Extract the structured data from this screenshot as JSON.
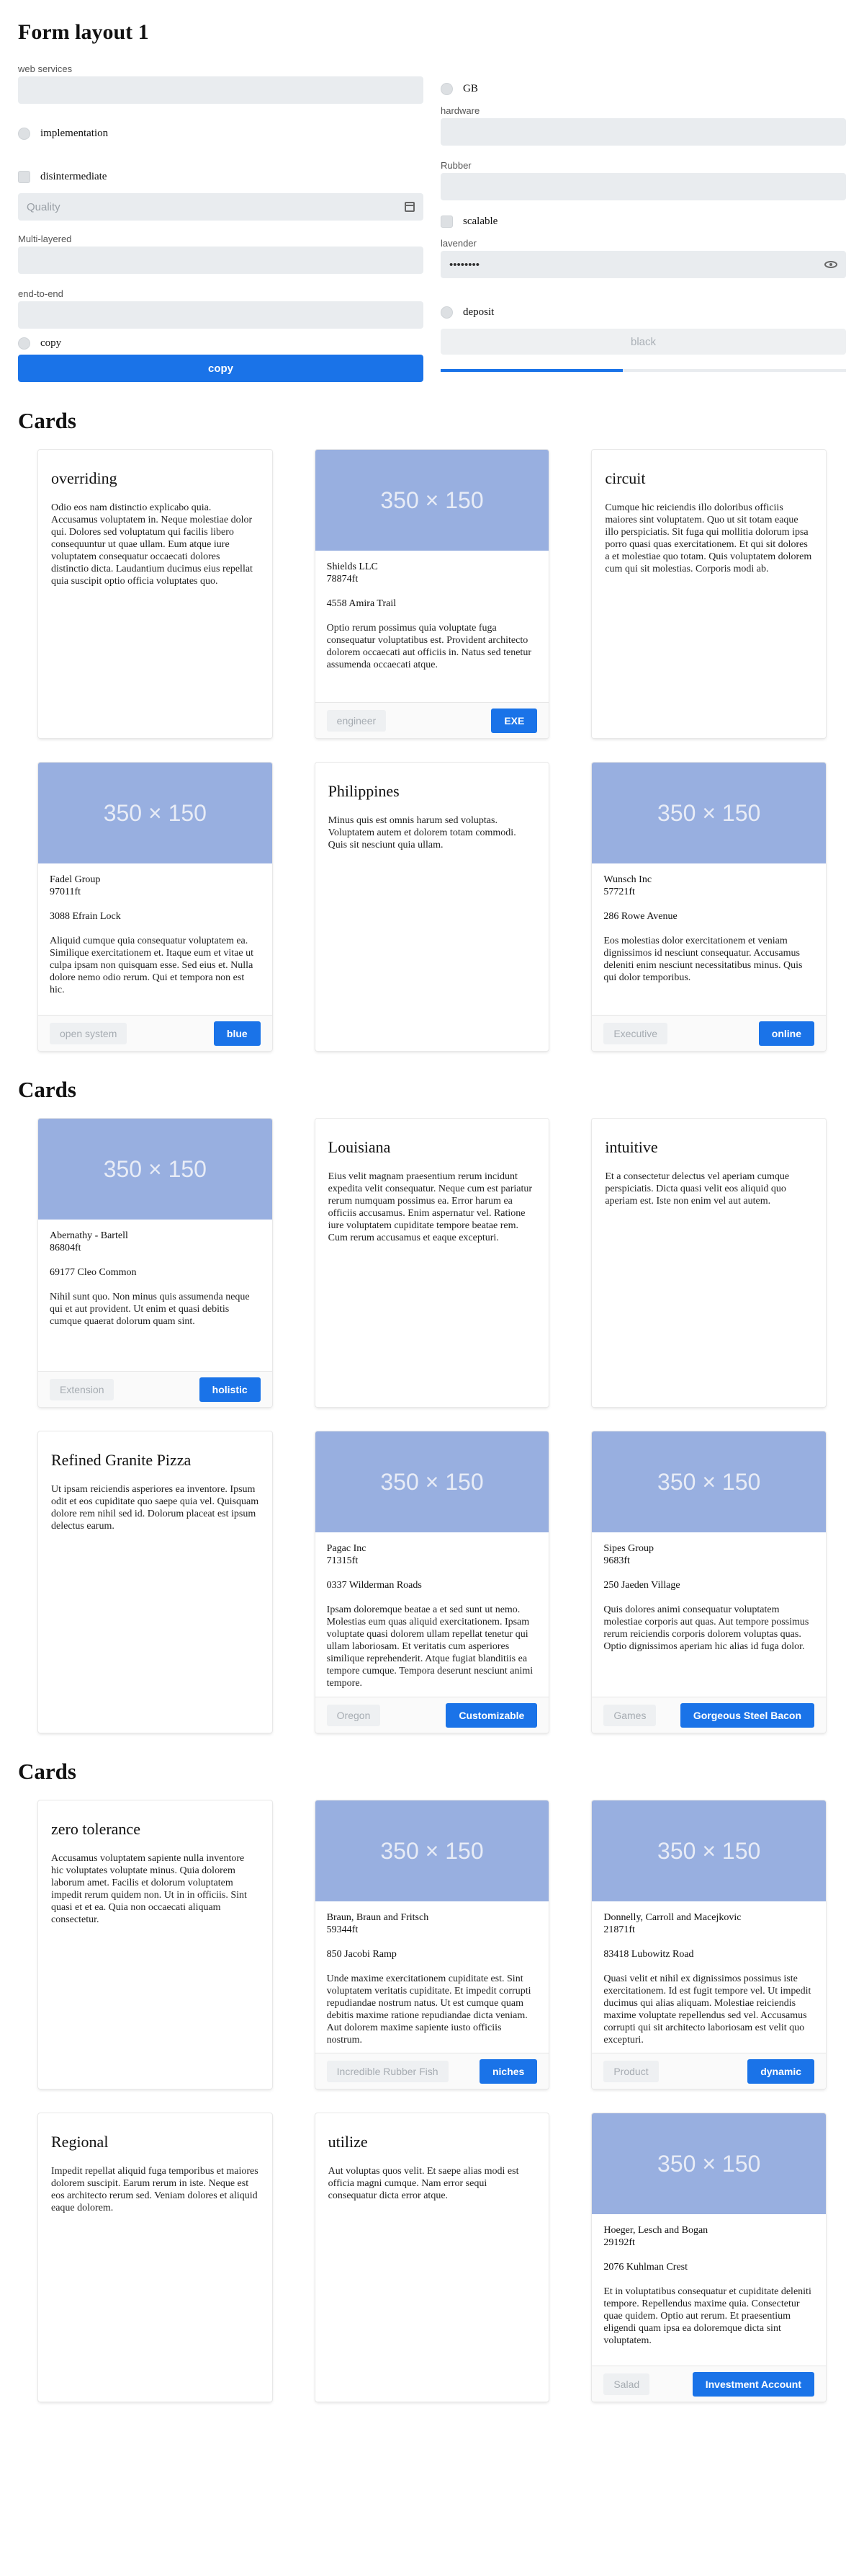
{
  "form": {
    "title": "Form layout 1",
    "left": {
      "web_services_label": "web services",
      "implementation_label": "implementation",
      "disintermediate_label": "disintermediate",
      "date_placeholder": "Quality",
      "multilayered_label": "Multi-layered",
      "end_to_end_label": "end-to-end",
      "copy_radio_label": "copy",
      "submit_label": "copy"
    },
    "right": {
      "gb_label": "GB",
      "hardware_label": "hardware",
      "rubber_label": "Rubber",
      "scalable_label": "scalable",
      "lavender_label": "lavender",
      "password_value": "••••••••",
      "deposit_label": "deposit",
      "disabled_button_label": "black",
      "progress_fraction": 0.45
    }
  },
  "sections": [
    {
      "title": "Cards",
      "rows": [
        [
          {
            "type": "text",
            "title": "overriding",
            "text": "Odio eos nam distinctio explicabo quia. Accusamus voluptatem in. Neque molestiae dolor qui. Dolores sed voluptatum qui facilis libero consequuntur ut quae ullam. Eum atque iure voluptatem consequatur occaecati dolores distinctio dicta. Laudantium ducimus eius repellat quia suscipit optio officia voluptates quo."
          },
          {
            "type": "image",
            "image_label": "350 × 150",
            "company": "Shields LLC",
            "size": "78874ft",
            "address": "4558 Amira Trail",
            "text": "Optio rerum possimus quia voluptate fuga consequatur voluptatibus est. Provident architecto dolorem occaecati aut officiis in. Natus sed tenetur assumenda occaecati atque.",
            "tag": "engineer",
            "action": "EXE"
          },
          {
            "type": "text",
            "title": "circuit",
            "text": "Cumque hic reiciendis illo doloribus officiis maiores sint voluptatem. Quo ut sit totam eaque illo perspiciatis. Sit fuga qui mollitia dolorum ipsa porro quasi quas exercitationem. Et qui sit dolores a et molestiae quo totam. Quis voluptatem dolorem cum qui sit molestias. Corporis modi ab."
          }
        ],
        [
          {
            "type": "image",
            "image_label": "350 × 150",
            "company": "Fadel Group",
            "size": "97011ft",
            "address": "3088 Efrain Lock",
            "text": "Aliquid cumque quia consequatur voluptatem ea. Similique exercitationem et. Itaque eum et vitae ut culpa ipsam non quisquam esse. Sed eius et. Nulla dolore nemo odio rerum. Qui et tempora non est hic.",
            "tag": "open system",
            "action": "blue"
          },
          {
            "type": "text",
            "title": "Philippines",
            "text": "Minus quis est omnis harum sed voluptas. Voluptatem autem et dolorem totam commodi. Quis sit nesciunt quia ullam."
          },
          {
            "type": "image",
            "image_label": "350 × 150",
            "company": "Wunsch Inc",
            "size": "57721ft",
            "address": "286 Rowe Avenue",
            "text": "Eos molestias dolor exercitationem et veniam dignissimos id nesciunt consequatur. Accusamus deleniti enim nesciunt necessitatibus minus. Quis qui dolor temporibus.",
            "tag": "Executive",
            "action": "online"
          }
        ]
      ]
    },
    {
      "title": "Cards",
      "rows": [
        [
          {
            "type": "image",
            "image_label": "350 × 150",
            "company": "Abernathy - Bartell",
            "size": "86804ft",
            "address": "69177 Cleo Common",
            "text": "Nihil sunt quo. Non minus quis assumenda neque qui et aut provident. Ut enim et quasi debitis cumque quaerat dolorum quam sint.",
            "tag": "Extension",
            "action": "holistic"
          },
          {
            "type": "text",
            "title": "Louisiana",
            "text": "Eius velit magnam praesentium rerum incidunt expedita velit consequatur. Neque cum est pariatur rerum numquam possimus ea. Error harum ea officiis accusamus. Enim aspernatur vel. Ratione iure voluptatem cupiditate tempore beatae rem. Cum rerum accusamus et eaque excepturi."
          },
          {
            "type": "text",
            "title": "intuitive",
            "text": "Et a consectetur delectus vel aperiam cumque perspiciatis. Dicta quasi velit eos aliquid quo aperiam est. Iste non enim vel aut autem."
          }
        ],
        [
          {
            "type": "text",
            "title": "Refined Granite Pizza",
            "text": "Ut ipsam reiciendis asperiores ea inventore. Ipsum odit et eos cupiditate quo saepe quia vel. Quisquam dolore rem nihil sed id. Dolorum placeat est ipsum delectus earum."
          },
          {
            "type": "image",
            "image_label": "350 × 150",
            "company": "Pagac Inc",
            "size": "71315ft",
            "address": "0337 Wilderman Roads",
            "text": "Ipsam doloremque beatae a et sed sunt ut nemo. Molestias eum quas aliquid exercitationem. Ipsam voluptate quasi dolorem ullam repellat tenetur qui ullam laboriosam. Et veritatis cum asperiores similique reprehenderit. Atque fugiat blanditiis ea tempore cumque. Tempora deserunt nesciunt animi tempore.",
            "tag": "Oregon",
            "action": "Customizable"
          },
          {
            "type": "image",
            "image_label": "350 × 150",
            "company": "Sipes Group",
            "size": "9683ft",
            "address": "250 Jaeden Village",
            "text": "Quis dolores animi consequatur voluptatem molestiae corporis aut quas. Aut tempore possimus rerum reiciendis corporis dolorem voluptas quas. Optio dignissimos aperiam hic alias id fuga dolor.",
            "tag": "Games",
            "action": "Gorgeous Steel Bacon"
          }
        ]
      ]
    },
    {
      "title": "Cards",
      "rows": [
        [
          {
            "type": "text",
            "title": "zero tolerance",
            "text": "Accusamus voluptatem sapiente nulla inventore hic voluptates voluptate minus. Quia dolorem laborum amet. Facilis et dolorum voluptatem impedit rerum quidem non. Ut in in officiis. Sint quasi et et ea. Quia non occaecati aliquam consectetur."
          },
          {
            "type": "image",
            "image_label": "350 × 150",
            "company": "Braun, Braun and Fritsch",
            "size": "59344ft",
            "address": "850 Jacobi Ramp",
            "text": "Unde maxime exercitationem cupiditate est. Sint voluptatem veritatis cupiditate. Et impedit corrupti repudiandae nostrum natus. Ut est cumque quam debitis maxime ratione repudiandae dicta veniam. Aut dolorem maxime sapiente iusto officiis nostrum.",
            "tag": "Incredible Rubber Fish",
            "action": "niches"
          },
          {
            "type": "image",
            "image_label": "350 × 150",
            "company": "Donnelly, Carroll and Macejkovic",
            "size": "21871ft",
            "address": "83418 Lubowitz Road",
            "text": "Quasi velit et nihil ex dignissimos possimus iste exercitationem. Id est fugit tempore vel. Ut impedit ducimus qui alias aliquam. Molestiae reiciendis maxime voluptate repellendus sed vel. Accusamus corrupti qui sit architecto laboriosam est velit quo excepturi.",
            "tag": "Product",
            "action": "dynamic"
          }
        ],
        [
          {
            "type": "text",
            "title": "Regional",
            "text": "Impedit repellat aliquid fuga temporibus et maiores dolorem suscipit. Earum rerum in iste. Neque est eos architecto rerum sed. Veniam dolores et aliquid eaque dolorem."
          },
          {
            "type": "text",
            "title": "utilize",
            "text": "Aut voluptas quos velit. Et saepe alias modi est officia magni cumque. Nam error sequi consequatur dicta error atque."
          },
          {
            "type": "image",
            "image_label": "350 × 150",
            "company": "Hoeger, Lesch and Bogan",
            "size": "29192ft",
            "address": "2076 Kuhlman Crest",
            "text": "Et in voluptatibus consequatur et cupiditate deleniti tempore. Repellendus maxime quia. Consectetur quae quidem. Optio aut rerum. Et praesentium eligendi quam ipsa ea doloremque dicta sint voluptatem.",
            "tag": "Salad",
            "action": "Investment Account"
          }
        ]
      ]
    }
  ]
}
